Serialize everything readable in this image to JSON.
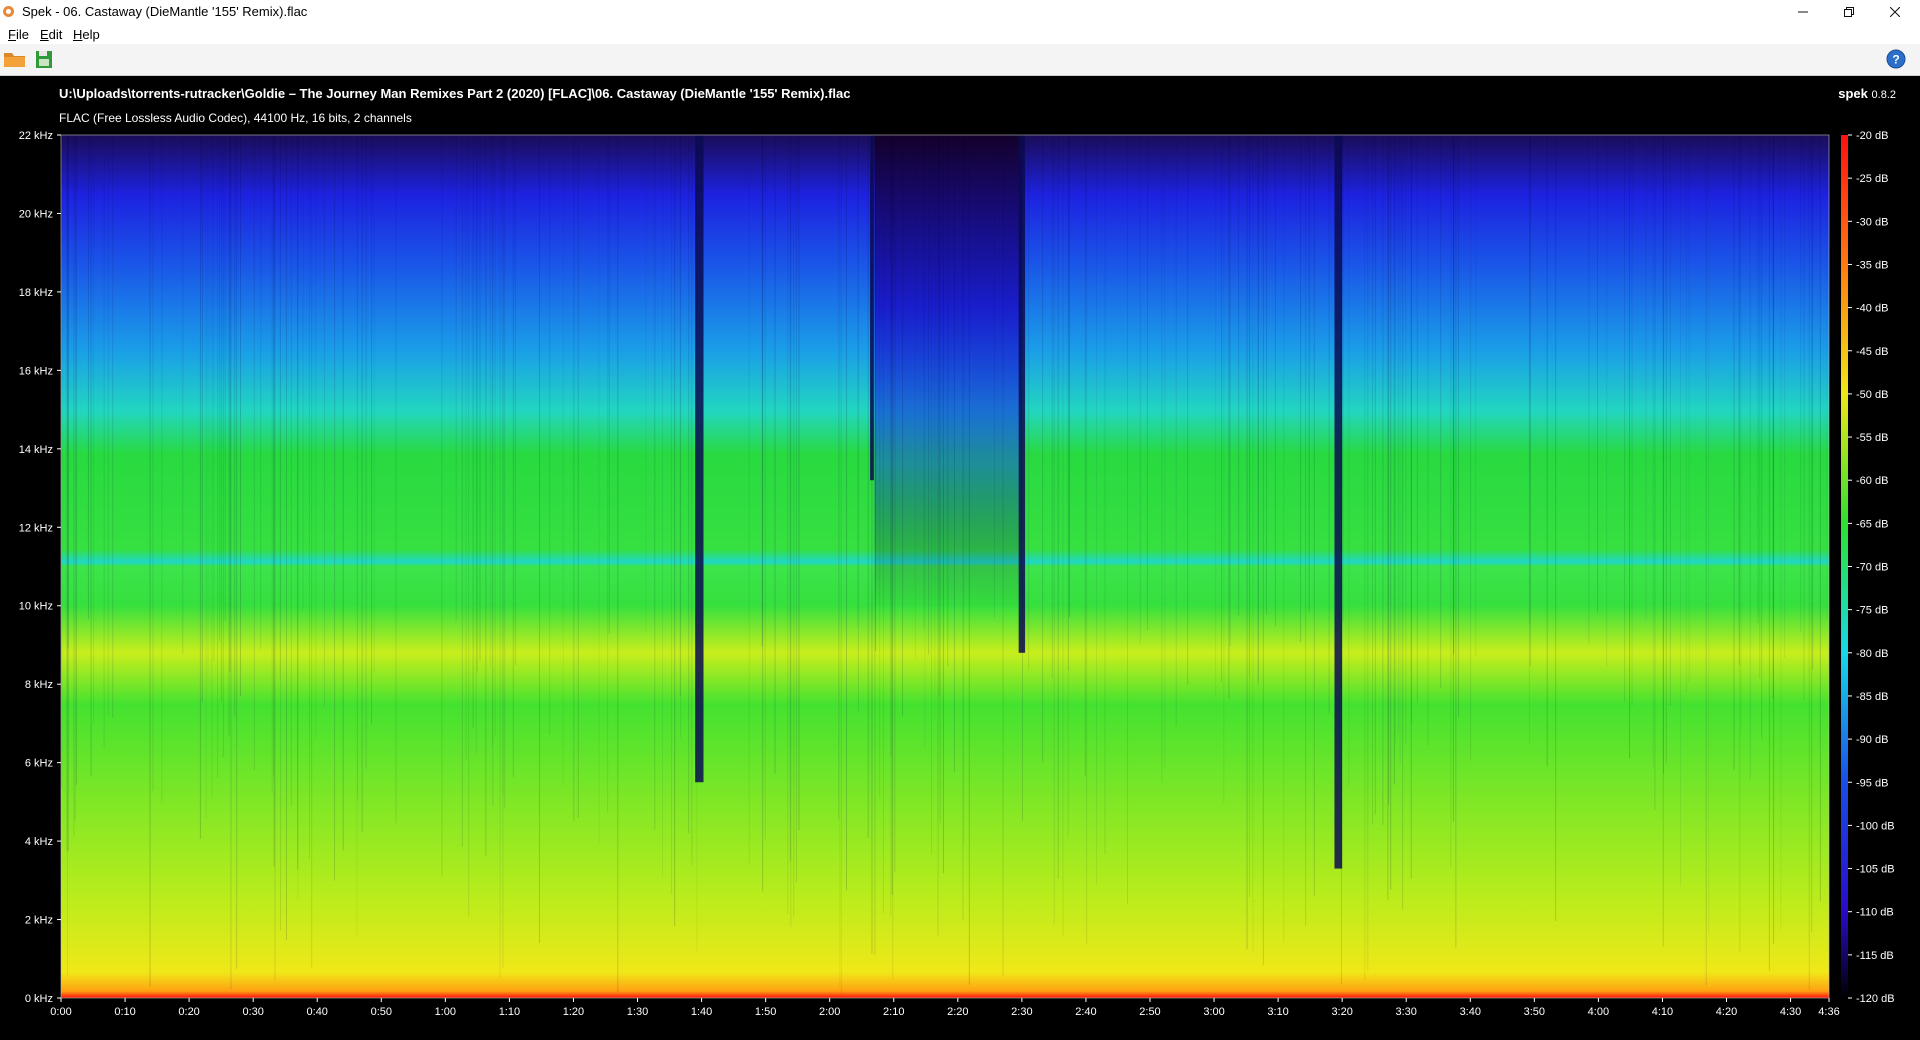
{
  "window": {
    "title": "Spek - 06. Castaway (DieMantle '155' Remix).flac",
    "controls": {
      "minimize_icon": "minimize-icon",
      "maximize_icon": "restore-icon",
      "close_icon": "close-icon"
    }
  },
  "menu": {
    "items": [
      {
        "label": "File",
        "accel": "F",
        "rest": "ile"
      },
      {
        "label": "Edit",
        "accel": "E",
        "rest": "dit"
      },
      {
        "label": "Help",
        "accel": "H",
        "rest": "elp"
      }
    ]
  },
  "toolbar": {
    "open_icon": "folder-open-icon",
    "save_icon": "save-image-icon",
    "about_icon": "help-icon"
  },
  "info": {
    "file_path": "U:\\Uploads\\torrents-rutracker\\Goldie – The Journey Man Remixes Part 2 (2020) [FLAC]\\06. Castaway (DieMantle '155' Remix).flac",
    "codec": "FLAC (Free Lossless Audio Codec), 44100 Hz, 16 bits, 2 channels",
    "app_name": "spek",
    "app_version": "0.8.2"
  },
  "chart_data": {
    "type": "heatmap",
    "title": "",
    "xlabel": "",
    "ylabel": "",
    "xlim": [
      "0:00",
      "4:36"
    ],
    "ylim_khz": [
      0,
      22
    ],
    "zlim_db": [
      -120,
      -20
    ],
    "y_ticks": [
      "0 kHz",
      "2 kHz",
      "4 kHz",
      "6 kHz",
      "8 kHz",
      "10 kHz",
      "12 kHz",
      "14 kHz",
      "16 kHz",
      "18 kHz",
      "20 kHz",
      "22 kHz"
    ],
    "x_ticks": [
      "0:00",
      "0:10",
      "0:20",
      "0:30",
      "0:40",
      "0:50",
      "1:00",
      "1:10",
      "1:20",
      "1:30",
      "1:40",
      "1:50",
      "2:00",
      "2:10",
      "2:20",
      "2:30",
      "2:40",
      "2:50",
      "3:00",
      "3:10",
      "3:20",
      "3:30",
      "3:40",
      "3:50",
      "4:00",
      "4:10",
      "4:20",
      "4:30",
      "4:36"
    ],
    "x_tick_seconds": [
      0,
      10,
      20,
      30,
      40,
      50,
      60,
      70,
      80,
      90,
      100,
      110,
      120,
      130,
      140,
      150,
      160,
      170,
      180,
      190,
      200,
      210,
      220,
      230,
      240,
      250,
      260,
      270,
      276
    ],
    "colorbar_ticks": [
      "-20 dB",
      "-25 dB",
      "-30 dB",
      "-35 dB",
      "-40 dB",
      "-45 dB",
      "-50 dB",
      "-55 dB",
      "-60 dB",
      "-65 dB",
      "-70 dB",
      "-75 dB",
      "-80 dB",
      "-85 dB",
      "-90 dB",
      "-95 dB",
      "-100 dB",
      "-105 dB",
      "-110 dB",
      "-115 dB",
      "-120 dB"
    ],
    "colorbar_db": [
      -20,
      -25,
      -30,
      -35,
      -40,
      -45,
      -50,
      -55,
      -60,
      -65,
      -70,
      -75,
      -80,
      -85,
      -90,
      -95,
      -100,
      -105,
      -110,
      -115,
      -120
    ],
    "duration_seconds": 276,
    "grid": false,
    "colors": {
      "low": "#000000",
      "blue": "#1e10e0",
      "cyan": "#18d8e8",
      "green": "#22e030",
      "yellow": "#e8f018",
      "orange": "#ff9a10",
      "red": "#ff1010"
    }
  }
}
